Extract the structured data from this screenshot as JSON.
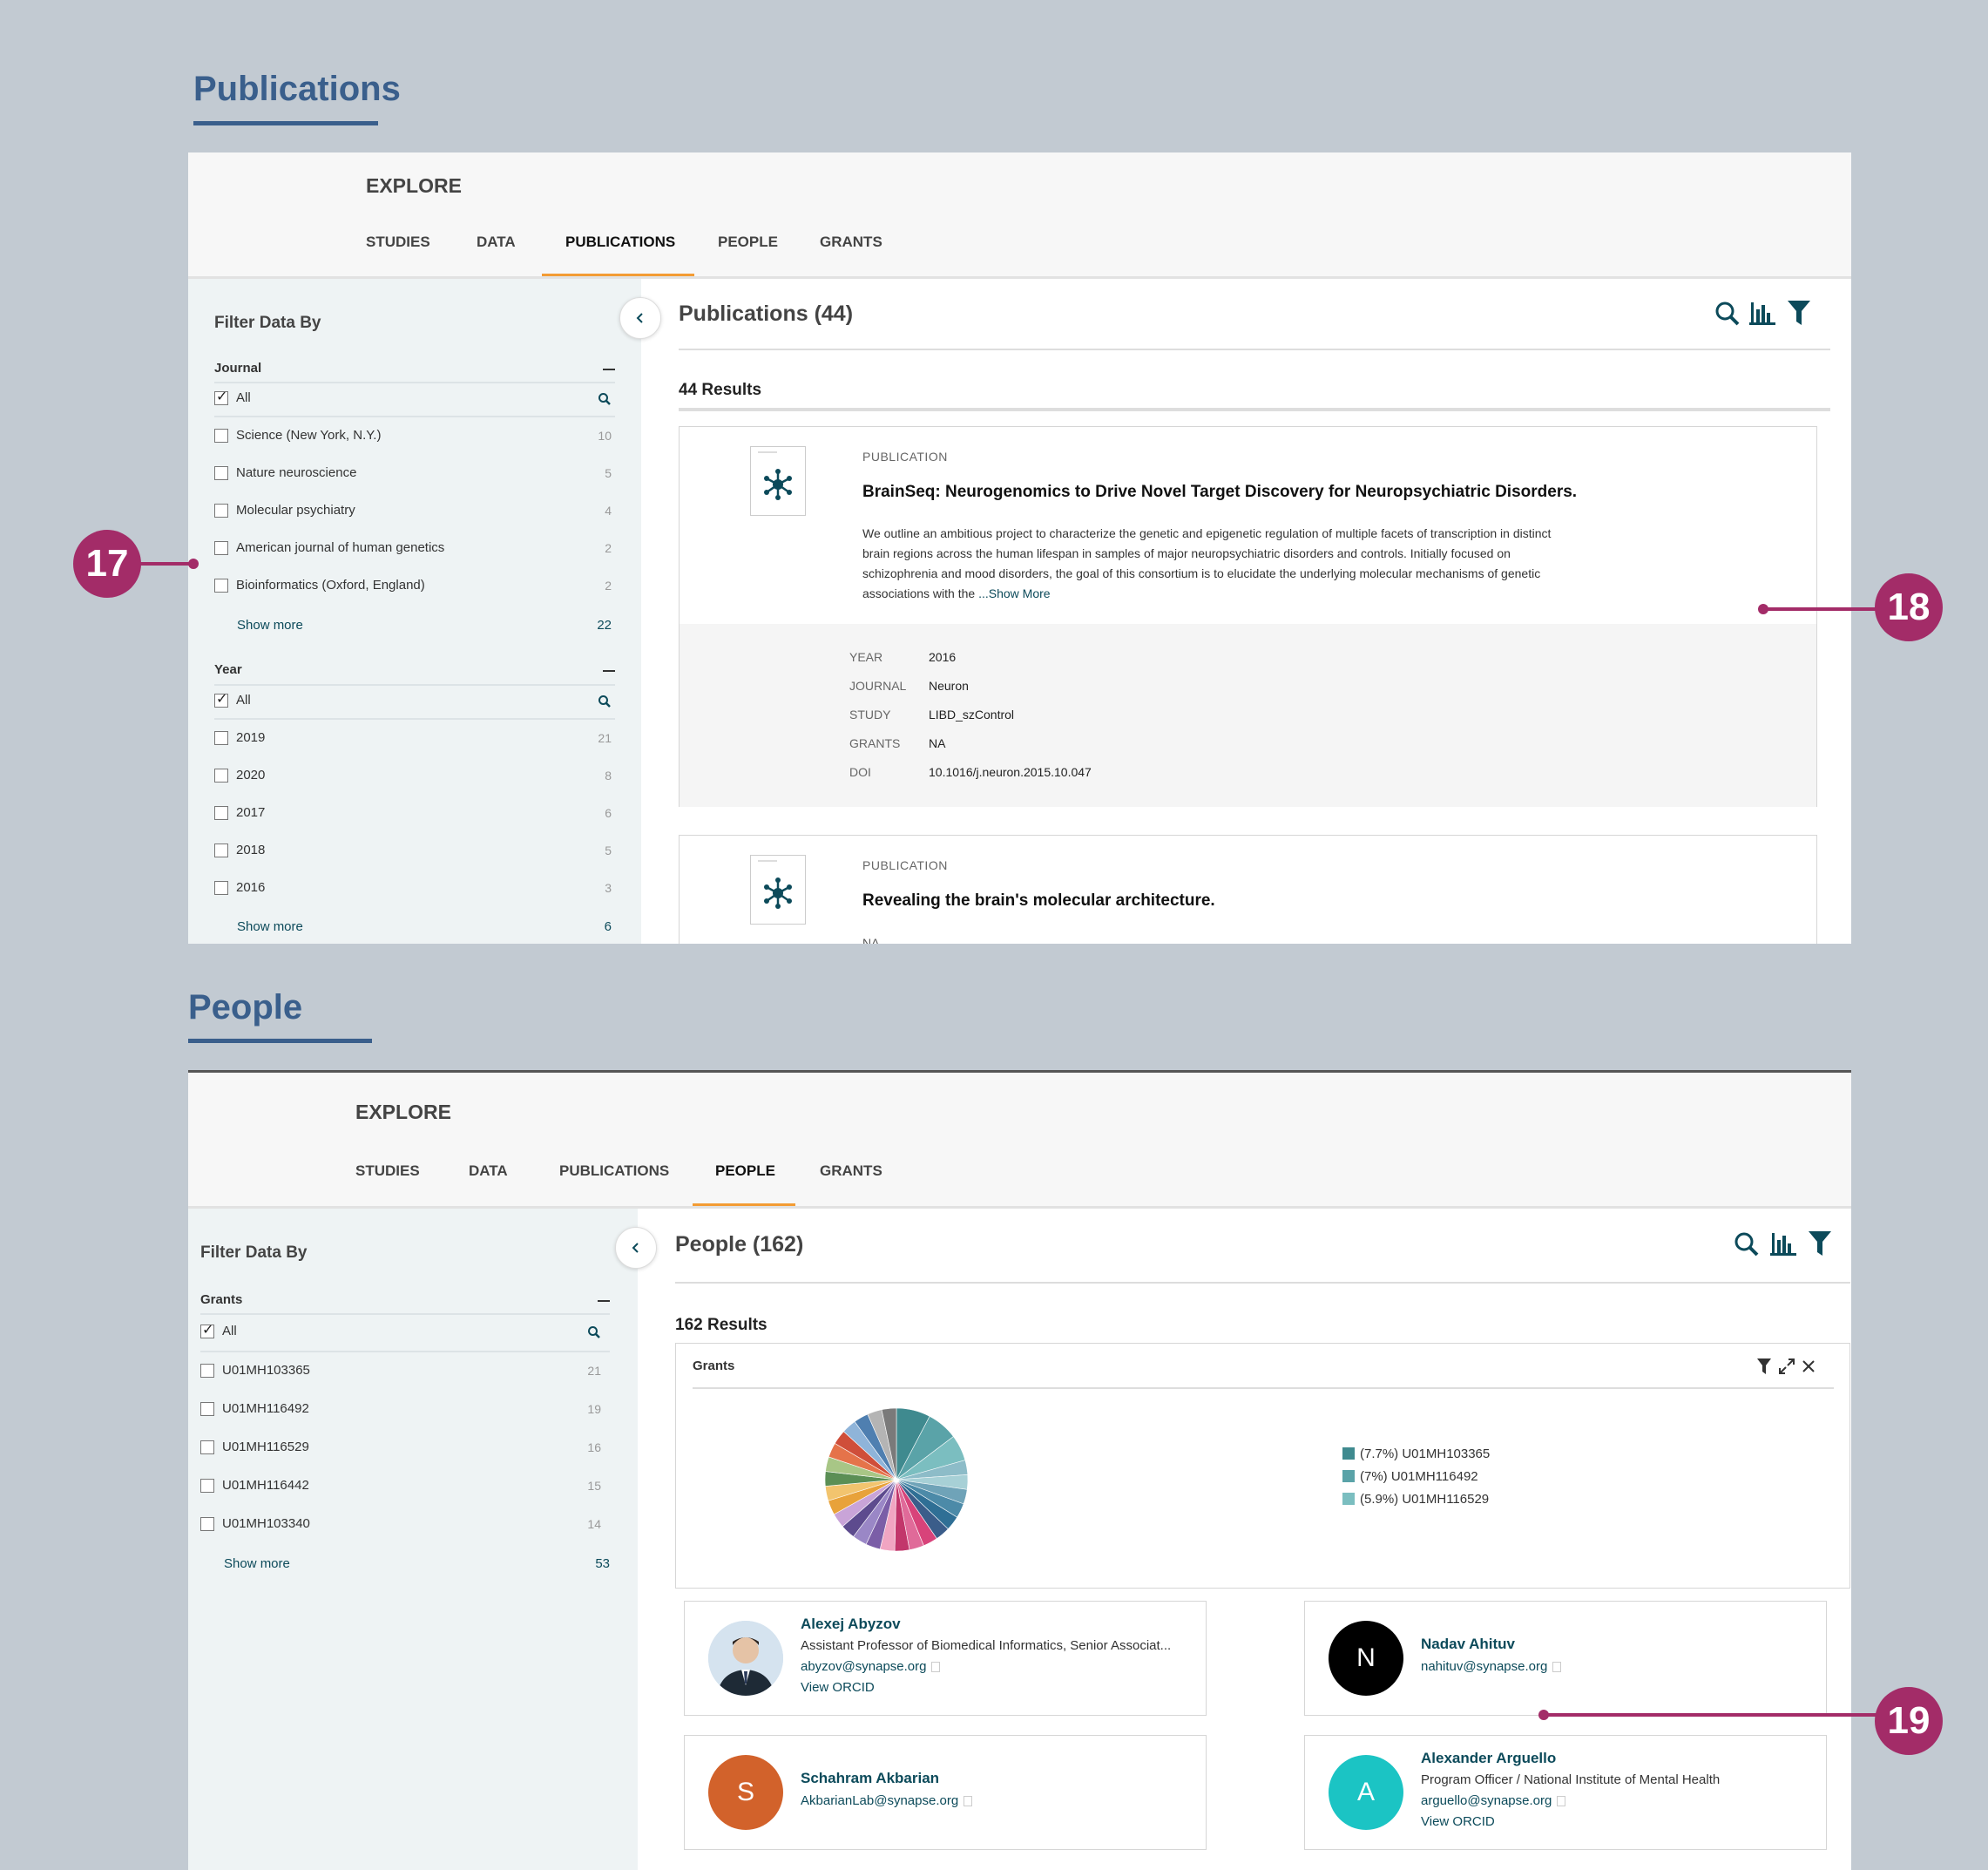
{
  "publications_section": {
    "heading": "Publications",
    "explore": "EXPLORE",
    "tabs": [
      "STUDIES",
      "DATA",
      "PUBLICATIONS",
      "PEOPLE",
      "GRANTS"
    ],
    "active_tab": "PUBLICATIONS",
    "filter_head": "Filter Data By",
    "journal": {
      "title": "Journal",
      "all": "All",
      "items": [
        {
          "label": "Science (New York, N.Y.)",
          "count": "10"
        },
        {
          "label": "Nature neuroscience",
          "count": "5"
        },
        {
          "label": "Molecular psychiatry",
          "count": "4"
        },
        {
          "label": "American journal of human genetics",
          "count": "2"
        },
        {
          "label": "Bioinformatics (Oxford, England)",
          "count": "2"
        }
      ],
      "show_more": "Show more",
      "show_more_count": "22"
    },
    "year": {
      "title": "Year",
      "all": "All",
      "items": [
        {
          "label": "2019",
          "count": "21"
        },
        {
          "label": "2020",
          "count": "8"
        },
        {
          "label": "2017",
          "count": "6"
        },
        {
          "label": "2018",
          "count": "5"
        },
        {
          "label": "2016",
          "count": "3"
        }
      ],
      "show_more": "Show more",
      "show_more_count": "6"
    },
    "main_title": "Publications (44)",
    "results": "44 Results",
    "card1": {
      "label": "PUBLICATION",
      "title": "BrainSeq: Neurogenomics to Drive Novel Target Discovery for Neuropsychiatric Disorders.",
      "abstract_lines": [
        "We outline an ambitious project to characterize the genetic and epigenetic regulation of multiple facets of transcription in distinct",
        "brain regions across the human lifespan in samples of major neuropsychiatric disorders and controls. Initially focused on",
        "schizophrenia and mood disorders, the goal of this consortium is to elucidate the underlying molecular mechanisms of genetic",
        "associations with the "
      ],
      "show_more": "...Show More",
      "meta": {
        "year_k": "YEAR",
        "year_v": "2016",
        "journal_k": "JOURNAL",
        "journal_v": "Neuron",
        "study_k": "STUDY",
        "study_v": "LIBD_szControl",
        "grants_k": "GRANTS",
        "grants_v": "NA",
        "doi_k": "DOI",
        "doi_v": "10.1016/j.neuron.2015.10.047"
      }
    },
    "card2": {
      "label": "PUBLICATION",
      "title": "Revealing the brain's molecular architecture.",
      "cut_text": "NA"
    }
  },
  "people_section": {
    "heading": "People",
    "explore": "EXPLORE",
    "tabs": [
      "STUDIES",
      "DATA",
      "PUBLICATIONS",
      "PEOPLE",
      "GRANTS"
    ],
    "active_tab": "PEOPLE",
    "filter_head": "Filter Data By",
    "grants": {
      "title": "Grants",
      "all": "All",
      "items": [
        {
          "label": "U01MH103365",
          "count": "21"
        },
        {
          "label": "U01MH116492",
          "count": "19"
        },
        {
          "label": "U01MH116529",
          "count": "16"
        },
        {
          "label": "U01MH116442",
          "count": "15"
        },
        {
          "label": "U01MH103340",
          "count": "14"
        }
      ],
      "show_more": "Show more",
      "show_more_count": "53"
    },
    "main_title": "People (162)",
    "results": "162 Results",
    "chart_panel_title": "Grants",
    "legend": [
      {
        "label": "(7.7%) U01MH103365",
        "color": "#3f8a8f"
      },
      {
        "label": "(7%) U01MH116492",
        "color": "#5aa3a8"
      },
      {
        "label": "(5.9%) U01MH116529",
        "color": "#7bbec0"
      }
    ],
    "people": [
      {
        "name": "Alexej Abyzov",
        "title": "Assistant Professor of Biomedical Informatics, Senior Associat...",
        "email": "abyzov@synapse.org",
        "orcid": "View ORCID"
      },
      {
        "name": "Nadav Ahituv",
        "initial": "N",
        "email": "nahituv@synapse.org",
        "color": "#000000"
      },
      {
        "name": "Schahram Akbarian",
        "initial": "S",
        "email": "AkbarianLab@synapse.org",
        "color": "#d2622b"
      },
      {
        "name": "Alexander Arguello",
        "initial": "A",
        "title": "Program Officer / National Institute of Mental Health",
        "email": "arguello@synapse.org",
        "orcid": "View ORCID",
        "color": "#1bc4c4"
      }
    ]
  },
  "annotations": {
    "a17": "17",
    "a18": "18",
    "a19": "19"
  },
  "chart_data": {
    "type": "pie",
    "title": "Grants",
    "categories": [
      "U01MH103365",
      "U01MH116492",
      "U01MH116529"
    ],
    "values": [
      7.7,
      7.0,
      5.9
    ],
    "unit": "%",
    "legend": "right"
  }
}
